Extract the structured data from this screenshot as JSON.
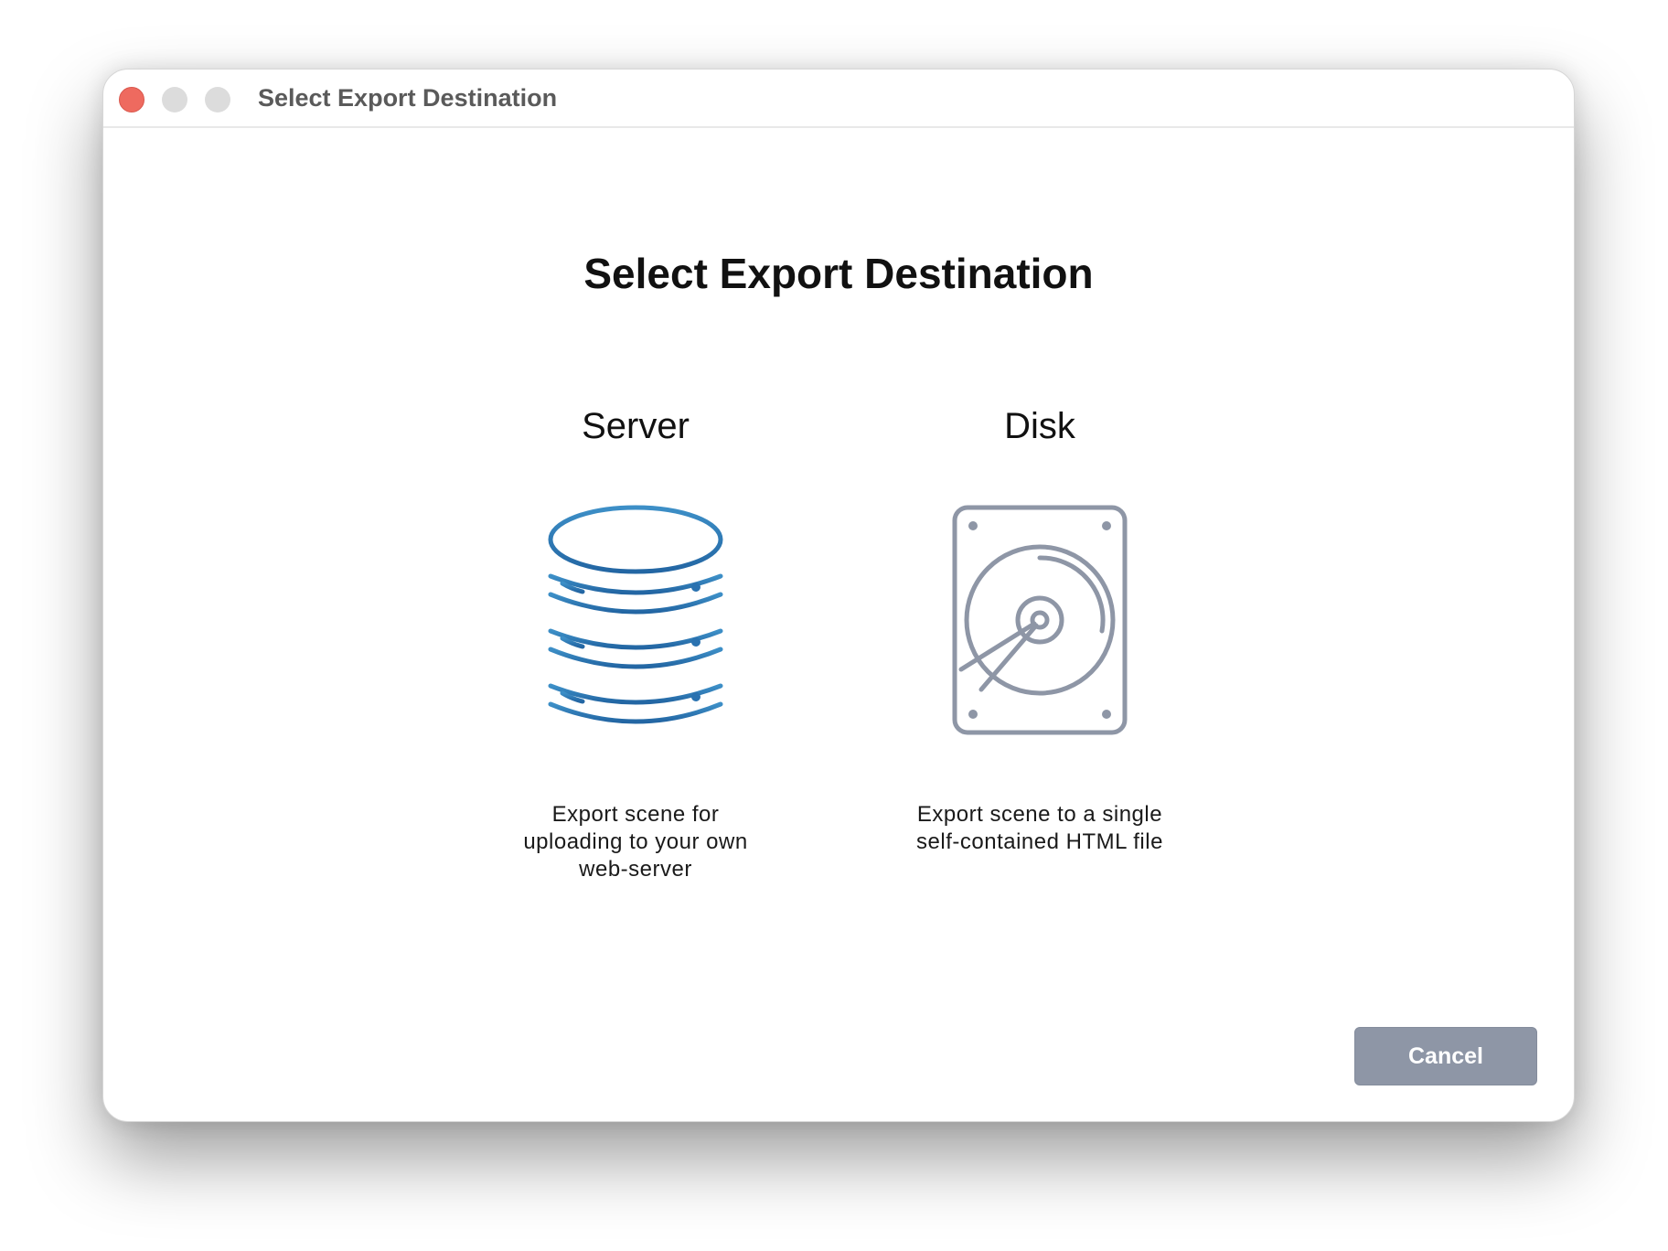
{
  "window": {
    "title": "Select Export Destination"
  },
  "main": {
    "heading": "Select Export Destination",
    "options": [
      {
        "label": "Server",
        "description": "Export scene for\nuploading to your own\nweb-server",
        "icon": "database-icon",
        "color": "#2a72b0"
      },
      {
        "label": "Disk",
        "description": "Export scene to a single\nself-contained HTML file",
        "icon": "hard-drive-icon",
        "color": "#8e96a6"
      }
    ]
  },
  "footer": {
    "cancel_label": "Cancel"
  }
}
